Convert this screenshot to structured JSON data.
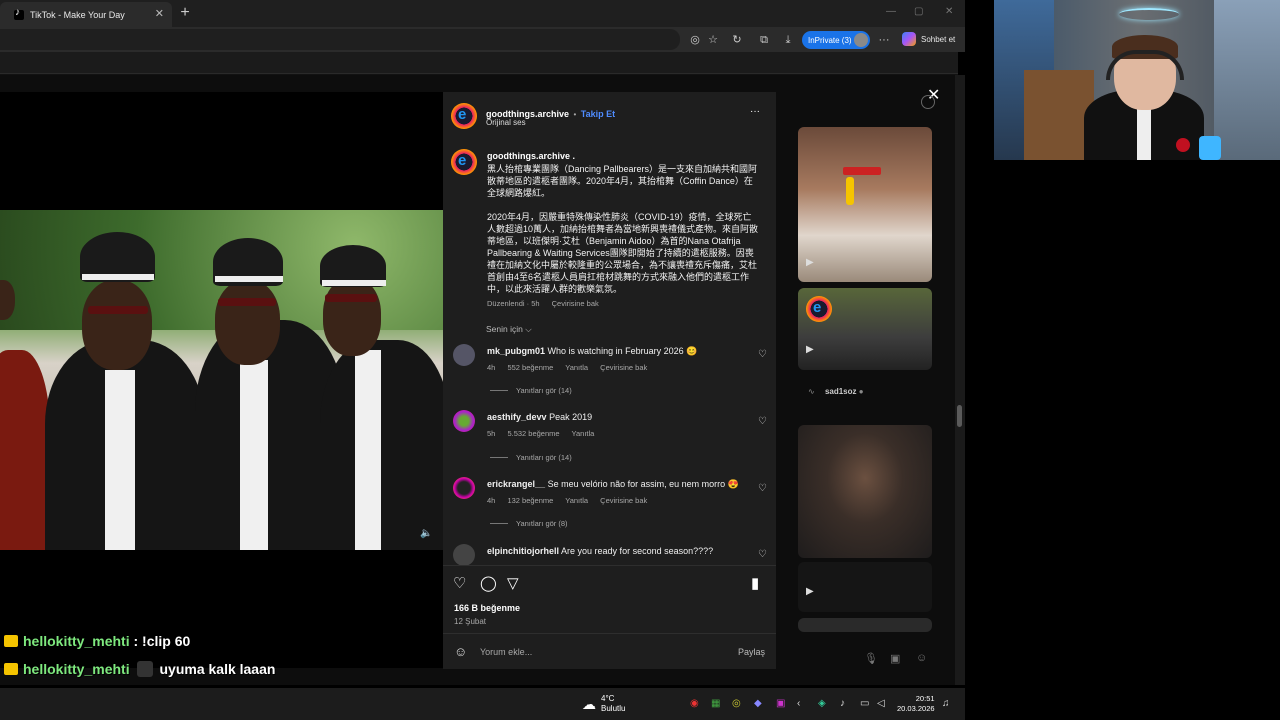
{
  "browser": {
    "tab_title": "TikTok - Make Your Day",
    "tab_close": "✕",
    "new_tab": "+",
    "inprivate_label": "InPrivate (3)",
    "copilot_label": "Sohbet et"
  },
  "post": {
    "username": "goodthings.archive",
    "separator": "•",
    "follow_label": "Takip Et",
    "sound": "Orijinal ses",
    "more": "···",
    "caption_user": "goodthings.archive .",
    "caption_p1": "黑人抬棺專業團隊（Dancing Pallbearers）是一支來自加納共和國阿散蒂地區的遣柩者團隊。2020年4月，其抬棺舞（Coffin Dance）在全球網路爆紅。",
    "caption_p2": "2020年4月，因嚴重特殊傳染性肺炎（COVID-19）疫情，全球死亡人數超過10萬人，加納抬棺舞者為當地新興喪禮儀式產物。來自阿散蒂地區，以班傑明·艾杜（Benjamin Aidoo）為首的Nana Otafrija Pallbearing & Waiting Services團隊即開始了持續的遣柩服務。因喪禮在加納文化中屬於較隆重的公眾場合，為不讓喪禮充斥傷痛，艾杜首創由4至6名遣柩人員肩扛棺材跳舞的方式來融入他們的遣柩工作中，以此來活躍人群的歡樂氣氛。",
    "caption_meta_edited": "Düzenlendi · 5h",
    "caption_meta_translate": "Çevirisine bak",
    "for_you": "Senin için ⌵",
    "likes": "166 B beğenme",
    "date": "12 Şubat",
    "comment_placeholder": "Yorum ekle...",
    "share_label": "Paylaş"
  },
  "comments": [
    {
      "user": "mk_pubgm01",
      "text": "Who is watching in February 2026 😊",
      "time": "4h",
      "likes": "552 beğenme",
      "reply": "Yanıtla",
      "translate": "Çevirisine bak",
      "replies": "Yanıtları gör (14)"
    },
    {
      "user": "aesthify_devv",
      "text": "Peak 2019",
      "time": "5h",
      "likes": "5.532 beğenme",
      "reply": "Yanıtla",
      "translate": "",
      "replies": "Yanıtları gör (14)"
    },
    {
      "user": "erickrangel__",
      "text": "Se meu velório não for assim, eu nem morro 😍",
      "time": "4h",
      "likes": "132 beğenme",
      "reply": "Yanıtla",
      "translate": "Çevirisine bak",
      "replies": "Yanıtları gör (8)"
    },
    {
      "user": "elpinchitiojorhell",
      "text": "Are you ready for second season????"
    }
  ],
  "right_column": {
    "profile_name": "sad1soz"
  },
  "chat": [
    {
      "user": "hellokitty_mehti",
      "message": ": !clip 60"
    },
    {
      "user": "hellokitty_mehti",
      "message": "uyuma kalk laaan"
    }
  ],
  "taskbar": {
    "temp": "4°C",
    "weather": "Bulutlu",
    "time": "20:51",
    "date": "20.03.2026"
  },
  "colors": {
    "accent_blue": "#4f8cff",
    "chat_user_green": "#7ee87e",
    "panel_bg": "#1e1e1e"
  }
}
